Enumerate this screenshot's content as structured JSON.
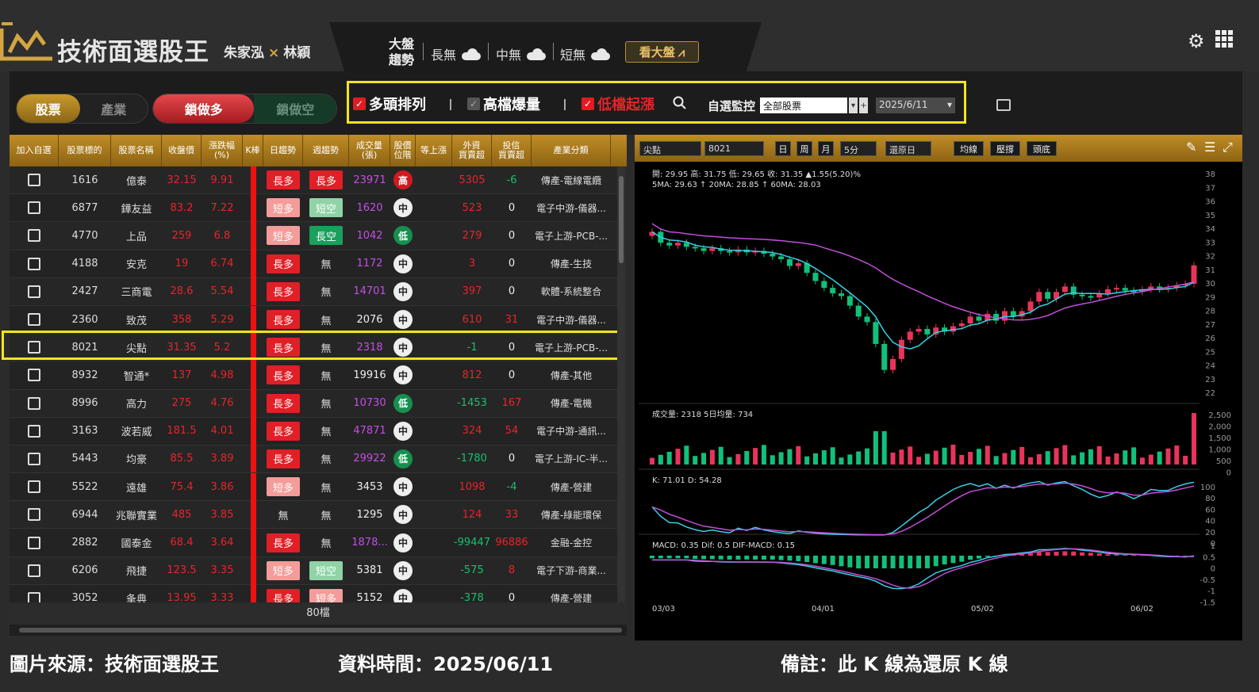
{
  "header": {
    "title": "技術面選股王",
    "authors_a": "朱家泓",
    "authors_x": "×",
    "authors_b": "林穎",
    "market_line1": "大盤",
    "market_line2": "趨勢",
    "long": "長無",
    "mid": "中無",
    "short": "短無",
    "view_market": "看大盤"
  },
  "toolbar": {
    "seg1_on": "股票",
    "seg1_off": "產業",
    "seg2_on": "鎖做多",
    "seg2_off": "鎖做空",
    "filter1": "多頭排列",
    "filter2": "高檔爆量",
    "filter3": "低檔起漲",
    "watch_label": "自選監控",
    "watch_value": "全部股票",
    "date_value": "2025/6/11"
  },
  "table": {
    "headers": [
      "加入自選",
      "股票標的",
      "股票名稱",
      "收盤價",
      "漲跌幅\n(%)",
      "K棒",
      "日趨勢",
      "週趨勢",
      "成交量\n(張)",
      "股價\n位階",
      "等上漲",
      "外資\n買賣超",
      "投信\n買賣超",
      "產業分類"
    ],
    "rows": [
      {
        "code": "1616",
        "name": "億泰",
        "close": "32.15",
        "pct": "9.91",
        "day": "長多",
        "week": "長多",
        "vol": "23971",
        "pos": "高",
        "foreign": "5305",
        "trust": "-6",
        "ind": "傳產-電線電纜"
      },
      {
        "code": "6877",
        "name": "鏵友益",
        "close": "83.2",
        "pct": "7.22",
        "day": "短多",
        "week": "短空",
        "vol": "1620",
        "pos": "中",
        "foreign": "523",
        "trust": "0",
        "ind": "電子中游-儀器..."
      },
      {
        "code": "4770",
        "name": "上品",
        "close": "259",
        "pct": "6.8",
        "day": "短多",
        "week": "長空",
        "vol": "1042",
        "pos": "低",
        "foreign": "279",
        "trust": "0",
        "ind": "電子上游-PCB-..."
      },
      {
        "code": "4188",
        "name": "安克",
        "close": "19",
        "pct": "6.74",
        "day": "長多",
        "week": "無",
        "vol": "1172",
        "pos": "中",
        "foreign": "3",
        "trust": "0",
        "ind": "傳產-生技"
      },
      {
        "code": "2427",
        "name": "三商電",
        "close": "28.6",
        "pct": "5.54",
        "day": "長多",
        "week": "無",
        "vol": "14701",
        "pos": "中",
        "foreign": "397",
        "trust": "0",
        "ind": "軟體-系統整合"
      },
      {
        "code": "2360",
        "name": "致茂",
        "close": "358",
        "pct": "5.29",
        "day": "長多",
        "week": "無",
        "vol": "2076",
        "pos": "中",
        "foreign": "610",
        "trust": "31",
        "ind": "電子中游-儀器..."
      },
      {
        "code": "8021",
        "name": "尖點",
        "close": "31.35",
        "pct": "5.2",
        "day": "長多",
        "week": "無",
        "vol": "2318",
        "pos": "中",
        "foreign": "-1",
        "trust": "0",
        "ind": "電子上游-PCB-..."
      },
      {
        "code": "8932",
        "name": "智通*",
        "close": "137",
        "pct": "4.98",
        "day": "長多",
        "week": "無",
        "vol": "19916",
        "pos": "中",
        "foreign": "812",
        "trust": "0",
        "ind": "傳產-其他"
      },
      {
        "code": "8996",
        "name": "高力",
        "close": "275",
        "pct": "4.76",
        "day": "長多",
        "week": "無",
        "vol": "10730",
        "pos": "低",
        "foreign": "-1453",
        "trust": "167",
        "ind": "傳產-電機"
      },
      {
        "code": "3163",
        "name": "波若威",
        "close": "181.5",
        "pct": "4.01",
        "day": "長多",
        "week": "無",
        "vol": "47871",
        "pos": "中",
        "foreign": "324",
        "trust": "54",
        "ind": "電子中游-通訊..."
      },
      {
        "code": "5443",
        "name": "均豪",
        "close": "85.5",
        "pct": "3.89",
        "day": "長多",
        "week": "無",
        "vol": "29922",
        "pos": "低",
        "foreign": "-1780",
        "trust": "0",
        "ind": "電子上游-IC-半..."
      },
      {
        "code": "5522",
        "name": "遠雄",
        "close": "75.4",
        "pct": "3.86",
        "day": "短多",
        "week": "無",
        "vol": "3453",
        "pos": "中",
        "foreign": "1098",
        "trust": "-4",
        "ind": "傳產-營建"
      },
      {
        "code": "6944",
        "name": "兆聯實業",
        "close": "485",
        "pct": "3.85",
        "day": "無",
        "week": "無",
        "vol": "1295",
        "pos": "中",
        "foreign": "124",
        "trust": "33",
        "ind": "傳產-綠能環保"
      },
      {
        "code": "2882",
        "name": "國泰金",
        "close": "68.4",
        "pct": "3.64",
        "day": "長多",
        "week": "無",
        "vol": "1878...",
        "pos": "中",
        "foreign": "-99447",
        "trust": "96886",
        "ind": "金融-金控"
      },
      {
        "code": "6206",
        "name": "飛捷",
        "close": "123.5",
        "pct": "3.35",
        "day": "短多",
        "week": "短空",
        "vol": "5381",
        "pos": "中",
        "foreign": "-575",
        "trust": "8",
        "ind": "電子下游-商業..."
      },
      {
        "code": "3052",
        "name": "夆典",
        "close": "13.95",
        "pct": "3.33",
        "day": "長多",
        "week": "短多",
        "vol": "5152",
        "pos": "中",
        "foreign": "-378",
        "trust": "0",
        "ind": "傳產-營建"
      }
    ],
    "count": "80檔"
  },
  "chart": {
    "mode": "尖點",
    "code": "8021",
    "btn_day": "日",
    "btn_week": "周",
    "btn_month": "月",
    "interval": "5分",
    "restore": "還原日",
    "btn_ma": "均線",
    "btn_pressure": "壓撐",
    "btn_head": "頭底",
    "ohlc_text": "開: 29.95  高: 31.75  低: 29.65  收: 31.35  ▲1.55(5.20)%",
    "ma_text": "5MA: 29.63  ↑ 20MA: 28.85  ↑ 60MA: 28.03",
    "vol_text": "成交量: 2318  5日均量: 734",
    "kd_text": "K: 71.01  D: 54.28",
    "macd_text": "MACD: 0.35  Dif: 0.5  DIF-MACD: 0.15",
    "price_ticks": [
      "38",
      "37",
      "36",
      "35",
      "34",
      "33",
      "32",
      "31",
      "30",
      "29",
      "28",
      "27",
      "26",
      "25",
      "24",
      "23",
      "22"
    ],
    "vol_ticks": [
      "2,500",
      "2,000",
      "1,500",
      "1,000",
      "500",
      "0"
    ],
    "kd_ticks": [
      "100",
      "80",
      "60",
      "40",
      "20",
      "0"
    ],
    "macd_ticks": [
      "1",
      "0.5",
      "0",
      "-0.5",
      "-1",
      "-1.5"
    ],
    "dates": [
      "03/03",
      "04/01",
      "05/02",
      "06/02"
    ],
    "close_series": [
      33.8,
      33,
      32.8,
      33,
      32.7,
      32.6,
      32.4,
      32.6,
      32.4,
      32.3,
      32.5,
      32.3,
      32.4,
      32.2,
      32,
      31.8,
      31.3,
      31.5,
      30.8,
      30.2,
      29.7,
      29.3,
      29.1,
      28.4,
      27.6,
      27.2,
      25.6,
      23.7,
      24.5,
      25.9,
      26.5,
      26.7,
      26.3,
      26.8,
      26.5,
      26.9,
      27.1,
      27.6,
      27.3,
      27.8,
      27.3,
      28,
      27.6,
      28,
      28.7,
      29.4,
      28.9,
      29.4,
      29.8,
      29.2,
      29.1,
      29,
      29.3,
      29.6,
      29.7,
      29.5,
      29.4,
      29.6,
      29.8,
      29.6,
      29.7,
      29.9,
      30,
      31.35
    ],
    "color_pos": "#e8345a",
    "color_neg": "#11c07a",
    "color_ma5": "#38d0e6",
    "color_ma20": "#c14fd8"
  },
  "footer": {
    "source": "圖片來源：技術面選股王",
    "date": "資料時間：2025/06/11",
    "note": "備註：此 K 線為還原 K 線"
  }
}
